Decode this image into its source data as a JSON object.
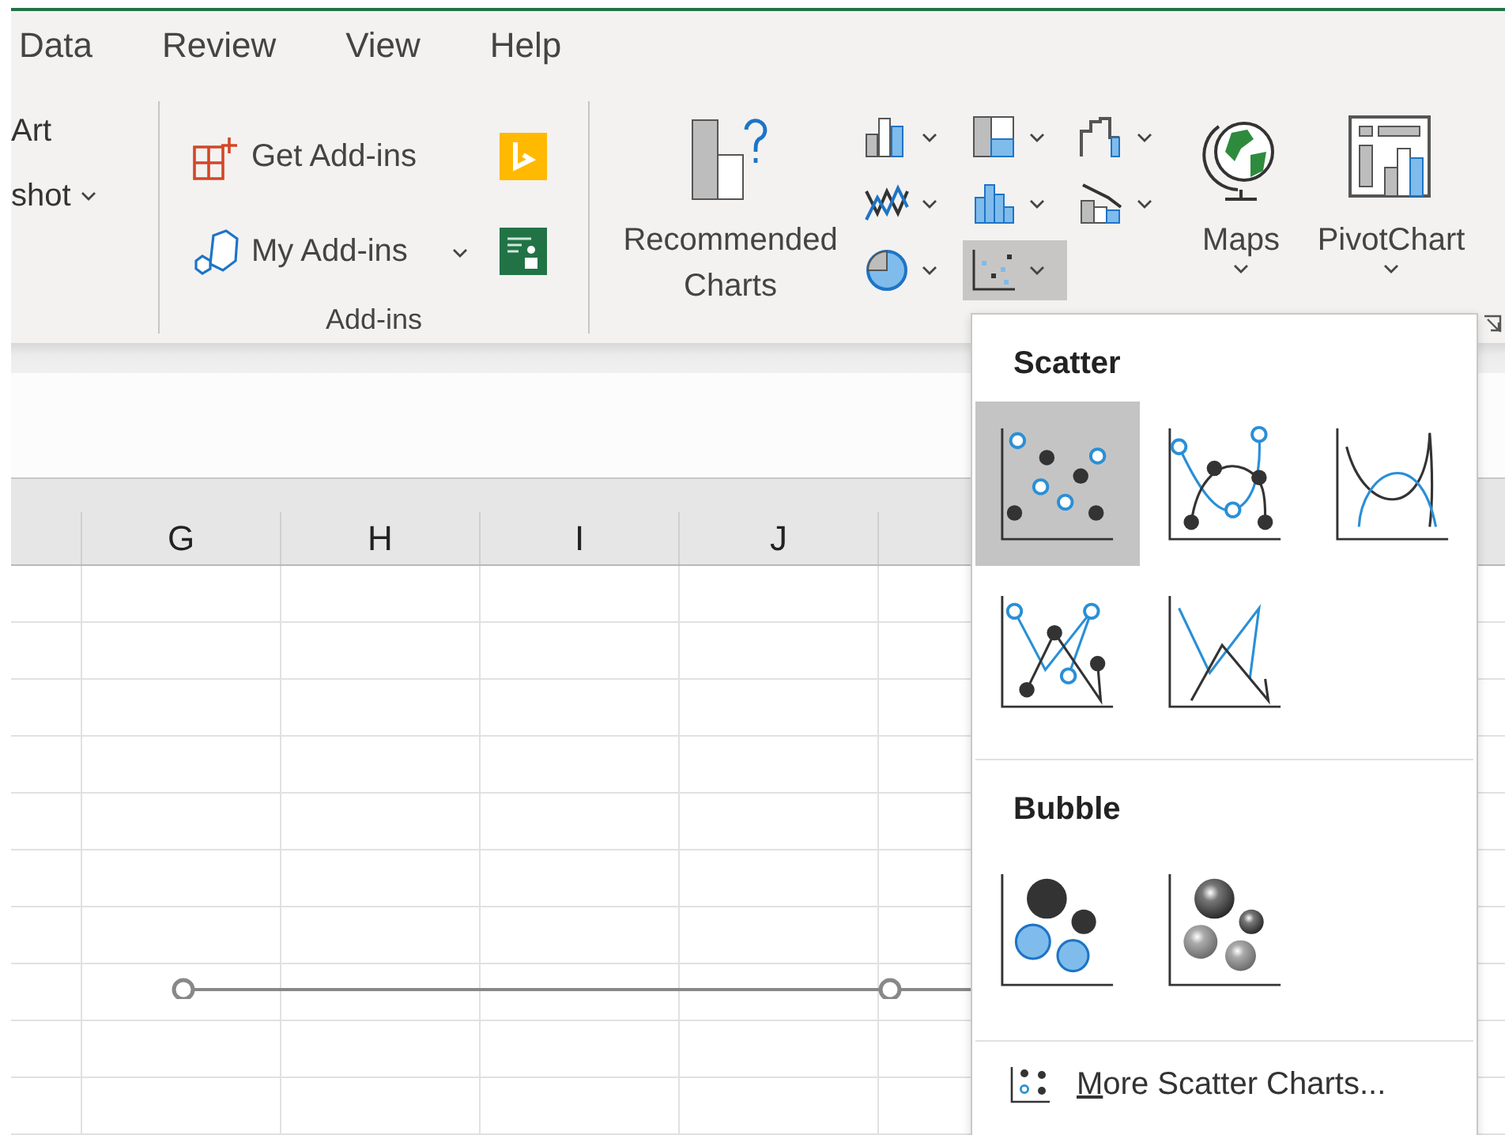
{
  "ribbon_tabs": [
    {
      "label": "Data",
      "selected": false
    },
    {
      "label": "Review",
      "selected": false
    },
    {
      "label": "View",
      "selected": false
    },
    {
      "label": "Help",
      "selected": false
    }
  ],
  "ribbon": {
    "cut_group": {
      "items": [
        {
          "label": "Art",
          "has_menu": false
        },
        {
          "label": "shot",
          "has_menu": true
        }
      ]
    },
    "addins_group": {
      "label": "Add-ins",
      "items": [
        {
          "kind": "get",
          "label": "Get Add-ins",
          "has_menu": false
        },
        {
          "kind": "my",
          "label": "My Add-ins",
          "has_menu": true
        }
      ]
    },
    "charts_group": {
      "recommended": {
        "label": "Recommended Charts"
      },
      "chart_types": [
        {
          "kind": "column",
          "selected": false
        },
        {
          "kind": "hierarchy",
          "selected": false
        },
        {
          "kind": "waterfall",
          "selected": false
        },
        {
          "kind": "line",
          "selected": false
        },
        {
          "kind": "statistic",
          "selected": false
        },
        {
          "kind": "combo",
          "selected": false
        },
        {
          "kind": "pie",
          "selected": false
        },
        {
          "kind": "scatter",
          "selected": true
        }
      ],
      "maps": {
        "label": "Maps"
      },
      "pivot_chart": {
        "label": "PivotChart"
      }
    }
  },
  "sheet": {
    "columns": [
      {
        "label": "G"
      },
      {
        "label": "H"
      },
      {
        "label": "I"
      },
      {
        "label": "J"
      }
    ]
  },
  "scatter_menu": {
    "sections": [
      {
        "title": "Scatter",
        "items": [
          {
            "kind": "markers",
            "selected": true
          },
          {
            "kind": "smooth_markers",
            "selected": false
          },
          {
            "kind": "smooth",
            "selected": false
          },
          {
            "kind": "straight_markers",
            "selected": false
          },
          {
            "kind": "straight",
            "selected": false
          }
        ]
      },
      {
        "title": "Bubble",
        "items": [
          {
            "kind": "bubble",
            "selected": false
          },
          {
            "kind": "bubble_3d",
            "selected": false
          }
        ]
      }
    ],
    "more_link": {
      "access_key": "M",
      "label_rest": "ore Scatter Charts..."
    }
  }
}
